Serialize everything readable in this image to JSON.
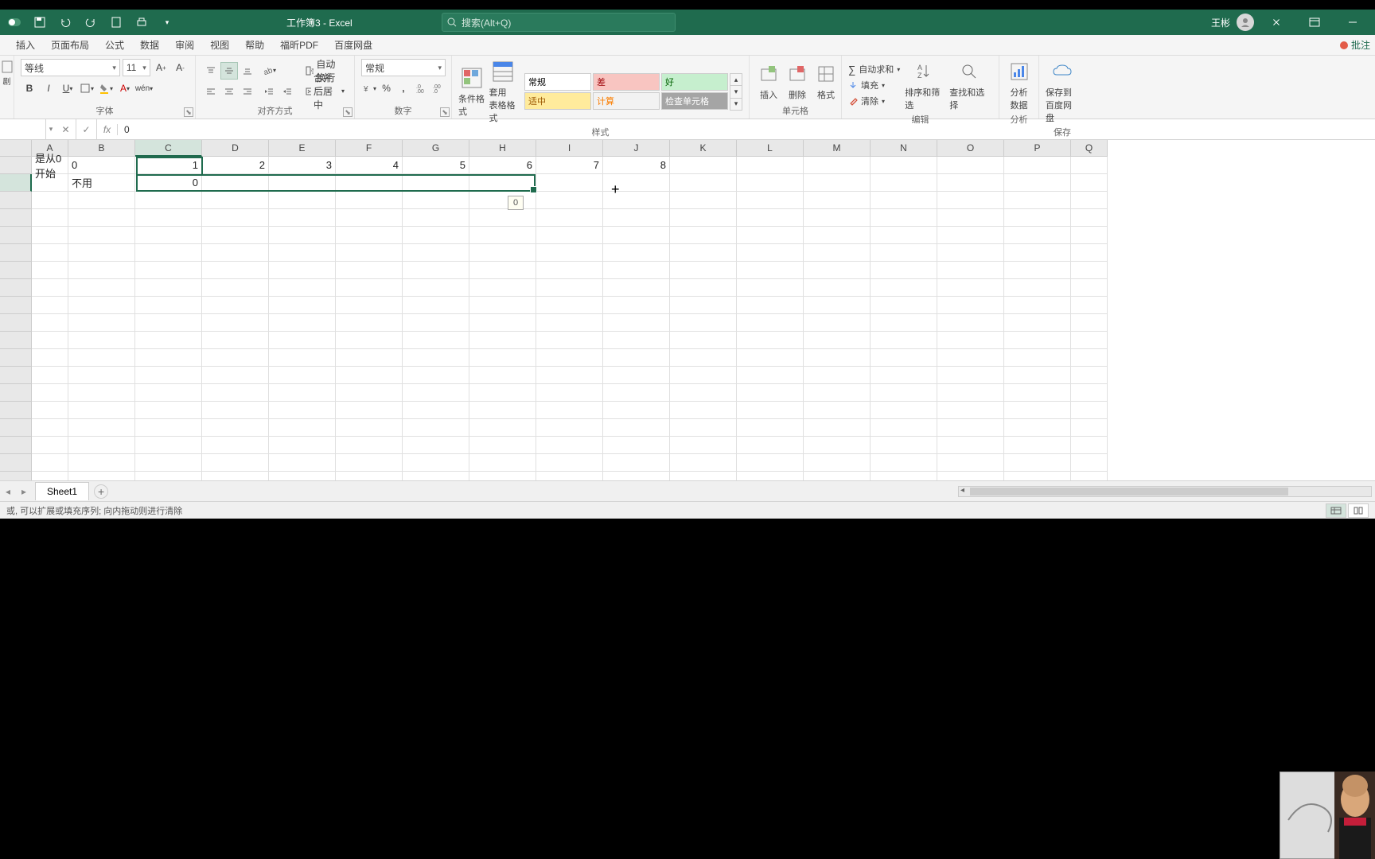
{
  "title": "工作簿3  -  Excel",
  "search_placeholder": "搜索(Alt+Q)",
  "user_name": "王彬",
  "tabs": [
    "插入",
    "页面布局",
    "公式",
    "数据",
    "审阅",
    "视图",
    "帮助",
    "福昕PDF",
    "百度网盘"
  ],
  "annotate": "批注",
  "font": {
    "name": "等线",
    "size": "11"
  },
  "ribbon": {
    "font_label": "字体",
    "align_label": "对齐方式",
    "number_label": "数字",
    "styles_label": "样式",
    "cells_label": "单元格",
    "editing_label": "编辑",
    "analyze_label": "分析",
    "save_label": "保存",
    "wrap": "自动换行",
    "merge": "合并后居中",
    "number_format": "常规",
    "cond_fmt": "条件格式",
    "table_fmt": "套用\n表格格式",
    "style_gallery": [
      {
        "t": "常规",
        "bg": "#ffffff",
        "c": "#000"
      },
      {
        "t": "差",
        "bg": "#f8c5c1",
        "c": "#9c0006"
      },
      {
        "t": "好",
        "bg": "#c6efce",
        "c": "#006100"
      },
      {
        "t": "适中",
        "bg": "#ffeb9c",
        "c": "#9c5700"
      },
      {
        "t": "计算",
        "bg": "#f2f2f2",
        "c": "#fa7d00"
      },
      {
        "t": "检查单元格",
        "bg": "#a5a5a5",
        "c": "#fff"
      }
    ],
    "insert": "插入",
    "delete": "删除",
    "format": "格式",
    "autosum": "自动求和",
    "fill": "填充",
    "clear": "清除",
    "sort": "排序和筛选",
    "find": "查找和选择",
    "analyze": "分析\n数据",
    "savecloud": "保存到\n百度网盘"
  },
  "formula_bar": {
    "value": "0"
  },
  "columns": [
    "A",
    "B",
    "C",
    "D",
    "E",
    "F",
    "G",
    "H",
    "I",
    "J",
    "K",
    "L",
    "M",
    "N",
    "O",
    "P",
    "Q"
  ],
  "row_count": 28,
  "cells": {
    "A1": "是从0开始",
    "B1": "0",
    "C1": "1",
    "D1": "2",
    "E1": "3",
    "F1": "4",
    "G1": "5",
    "H1": "6",
    "I1": "7",
    "J1": "8",
    "B2": "不用",
    "C2": "0"
  },
  "drag_tooltip": "0",
  "sheet_tab": "Sheet1",
  "status_text": "或,  可以扩展或填充序列;  向内拖动则进行清除"
}
